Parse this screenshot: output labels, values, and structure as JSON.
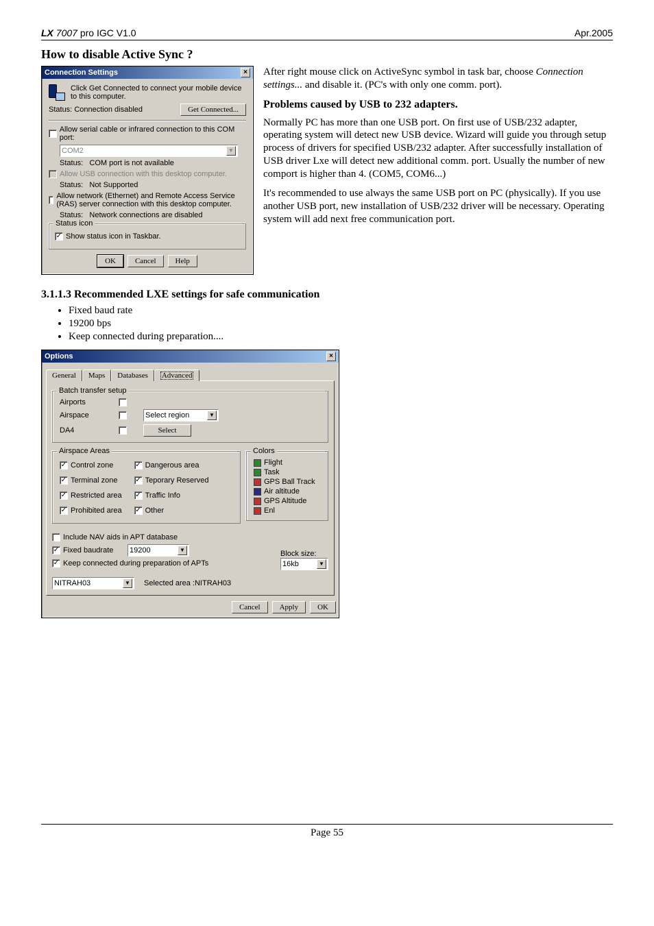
{
  "header": {
    "brand": "LX",
    "model": "7007",
    "product_suffix": " pro IGC  V1.0",
    "right": "Apr.2005"
  },
  "section_title": "How to disable Active Sync ?",
  "conn_dialog": {
    "title": "Connection Settings",
    "intro": "Click Get Connected to connect your mobile device to this computer.",
    "status_label": "Status:",
    "status_value": "Connection disabled",
    "get_connected": "Get Connected...",
    "allow_serial": "Allow serial cable or infrared connection to this COM port:",
    "com_select": "COM2",
    "serial_status": "COM port is not available",
    "allow_usb": "Allow USB connection with this desktop computer.",
    "usb_status": "Not Supported",
    "allow_net": "Allow network (Ethernet) and Remote Access Service (RAS) server connection with this desktop computer.",
    "net_status": "Network connections are disabled",
    "status_icon_group": "Status icon",
    "show_icon": "Show status icon in Taskbar.",
    "ok": "OK",
    "cancel": "Cancel",
    "help": "Help"
  },
  "rt": {
    "p1a": "After right mouse click on ActiveSync symbol in task bar, choose ",
    "p1i": "Connection settings...",
    "p1b": " and disable it. (PC's with only one comm. port).",
    "h": "Problems caused by USB to 232 adapters.",
    "p2": "Normally PC has more than one USB port. On first use of USB/232 adapter, operating system will detect new USB device. Wizard will guide you through setup process of drivers for specified USB/232 adapter.  After successfully installation of USB driver Lxe will detect new additional comm. port. Usually the number of new comport is higher than 4. (COM5, COM6...)",
    "p3": "It's recommended to use always the same USB port on PC (physically). If you use another USB port, new installation of USB/232 driver will be necessary. Operating system will add next free communication port."
  },
  "subsection": {
    "num": "3.1.1.3",
    "title": "   Recommended LXE settings for safe communication",
    "b1": "Fixed baud rate",
    "b2": "19200 bps",
    "b3": "Keep connected during preparation...."
  },
  "options": {
    "title": "Options",
    "tabs": {
      "t1": "General",
      "t2": "Maps",
      "t3": "Databases",
      "t4": "Advanced"
    },
    "batch_group": "Batch transfer setup",
    "airports": "Airports",
    "airspace": "Airspace",
    "da4": "DA4",
    "sel_region_placeholder": "Select region",
    "select_btn": "Select",
    "areas_group": "Airspace Areas",
    "a_ctrl": "Control zone",
    "a_term": "Terminal zone",
    "a_rest": "Restricted area",
    "a_proh": "Prohibited area",
    "a_dang": "Dangerous area",
    "a_tepo": "Teporary Reserved",
    "a_traf": "Traffic Info",
    "a_other": "Other",
    "colors_group": "Colors",
    "c_flight": "Flight",
    "c_task": "Task",
    "c_gpsb": "GPS Ball Track",
    "c_air": "Air altitude",
    "c_gpsa": "GPS Altitude",
    "c_enl": "Enl",
    "include_nav": "Include NAV aids in APT database",
    "fixed_baud": "Fixed baudrate",
    "baud_value": "19200",
    "block_label": "Block size:",
    "block_value": "16kb",
    "keep_conn": "Keep connected during preparation of APTs",
    "area_sel": "NITRAH03",
    "area_lbl": "Selected area :NITRAH03",
    "btn_cancel": "Cancel",
    "btn_apply": "Apply",
    "btn_ok": "OK"
  },
  "colors": {
    "flight": "#2a8a2a",
    "task": "#2a8a2a",
    "gpsb": "#c23030",
    "air": "#2a2a8a",
    "gpsa": "#c23030",
    "enl": "#c23030"
  },
  "footer": "Page 55"
}
